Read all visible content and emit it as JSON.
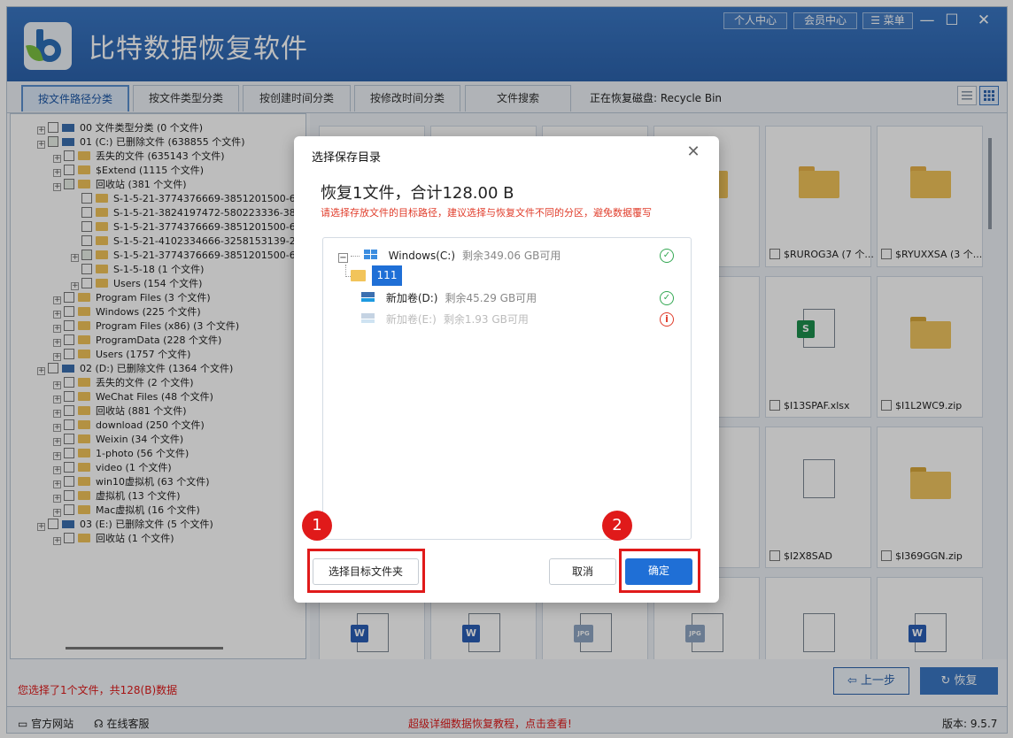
{
  "app": {
    "title": "比特数据恢复软件",
    "top_buttons": [
      "个人中心",
      "会员中心",
      "菜单"
    ],
    "recovering_disk": "正在恢复磁盘: Recycle Bin"
  },
  "tabs": [
    "按文件路径分类",
    "按文件类型分类",
    "按创建时间分类",
    "按修改时间分类",
    "文件搜索"
  ],
  "tree": {
    "items": [
      {
        "text": "00 文件类型分类  (0 个文件)",
        "level": 0,
        "type": "drive",
        "checked": false
      },
      {
        "text": "01 (C:) 已删除文件  (638855 个文件)",
        "level": 0,
        "type": "drive",
        "checked": true
      },
      {
        "text": "丢失的文件  (635143 个文件)",
        "level": 1,
        "type": "folder",
        "checked": false
      },
      {
        "text": "$Extend  (1115 个文件)",
        "level": 1,
        "type": "folder",
        "checked": false
      },
      {
        "text": "回收站  (381 个文件)",
        "level": 1,
        "type": "folder",
        "checked": true
      },
      {
        "text": "S-1-5-21-3774376669-3851201500-6941740",
        "level": 2,
        "type": "folder",
        "checked": false
      },
      {
        "text": "S-1-5-21-3824197472-580223336-38904055",
        "level": 2,
        "type": "folder",
        "checked": false
      },
      {
        "text": "S-1-5-21-3774376669-3851201500-6941740",
        "level": 2,
        "type": "folder",
        "checked": false
      },
      {
        "text": "S-1-5-21-4102334666-3258153139-2670408",
        "level": 2,
        "type": "folder",
        "checked": false
      },
      {
        "text": "S-1-5-21-3774376669-3851201500-6941740",
        "level": 2,
        "type": "folder",
        "checked": true
      },
      {
        "text": "S-1-5-18  (1 个文件)",
        "level": 2,
        "type": "folder",
        "checked": false
      },
      {
        "text": "Users  (154 个文件)",
        "level": 2,
        "type": "folder",
        "checked": false
      },
      {
        "text": "Program Files  (3 个文件)",
        "level": 1,
        "type": "folder",
        "checked": false
      },
      {
        "text": "Windows  (225 个文件)",
        "level": 1,
        "type": "folder",
        "checked": false
      },
      {
        "text": "Program Files (x86)  (3 个文件)",
        "level": 1,
        "type": "folder",
        "checked": false
      },
      {
        "text": "ProgramData  (228 个文件)",
        "level": 1,
        "type": "folder",
        "checked": false
      },
      {
        "text": "Users  (1757 个文件)",
        "level": 1,
        "type": "folder",
        "checked": false
      },
      {
        "text": "02 (D:) 已删除文件  (1364 个文件)",
        "level": 0,
        "type": "drive",
        "checked": false
      },
      {
        "text": "丢失的文件  (2 个文件)",
        "level": 1,
        "type": "folder",
        "checked": false
      },
      {
        "text": "WeChat Files  (48 个文件)",
        "level": 1,
        "type": "folder",
        "checked": false
      },
      {
        "text": "回收站  (881 个文件)",
        "level": 1,
        "type": "folder",
        "checked": false
      },
      {
        "text": "download  (250 个文件)",
        "level": 1,
        "type": "folder",
        "checked": false
      },
      {
        "text": "Weixin  (34 个文件)",
        "level": 1,
        "type": "folder",
        "checked": false
      },
      {
        "text": "1-photo  (56 个文件)",
        "level": 1,
        "type": "folder",
        "checked": false
      },
      {
        "text": "video  (1 个文件)",
        "level": 1,
        "type": "folder",
        "checked": false
      },
      {
        "text": "win10虚拟机  (63 个文件)",
        "level": 1,
        "type": "folder",
        "checked": false
      },
      {
        "text": "虚拟机  (13 个文件)",
        "level": 1,
        "type": "folder",
        "checked": false
      },
      {
        "text": "Mac虚拟机  (16 个文件)",
        "level": 1,
        "type": "folder",
        "checked": false
      },
      {
        "text": "03 (E:) 已删除文件  (5 个文件)",
        "level": 0,
        "type": "drive",
        "checked": false
      },
      {
        "text": "回收站  (1 个文件)",
        "level": 1,
        "type": "folder",
        "checked": false
      }
    ]
  },
  "grid": {
    "cards": [
      {
        "label": "(97 ...",
        "icon": "folder",
        "col": 3,
        "row": 0
      },
      {
        "label": "$RUROG3A (7 个...",
        "icon": "folder",
        "col": 4,
        "row": 0
      },
      {
        "label": "$RYUXXSA (3 个...",
        "icon": "folder",
        "col": 5,
        "row": 0
      },
      {
        "label": "$I13SPAF.xlsx",
        "icon": "excel",
        "col": 4,
        "row": 1
      },
      {
        "label": "$I1L2WC9.zip",
        "icon": "zip",
        "col": 5,
        "row": 1
      },
      {
        "label": "$I2X8SAD",
        "icon": "file",
        "col": 4,
        "row": 2
      },
      {
        "label": "$I369GGN.zip",
        "icon": "zip",
        "col": 5,
        "row": 2
      }
    ]
  },
  "status": {
    "selection": "您选择了1个文件，共128(B)数据",
    "prev_label": "上一步",
    "recover_label": "恢复"
  },
  "footer": {
    "site": "官方网站",
    "support": "在线客服",
    "promo": "超级详细数据恢复教程，点击查看!",
    "version": "版本: 9.5.7"
  },
  "dialog": {
    "title": "选择保存目录",
    "headline": "恢复1文件，合计128.00 B",
    "warning": "请选择存放文件的目标路径，建议选择与恢复文件不同的分区，避免数据覆写",
    "drives": [
      {
        "name": "Windows(C:)",
        "free": "剩余349.06 GB可用",
        "status": "ok"
      },
      {
        "name": "新加卷(D:)",
        "free": "剩余45.29 GB可用",
        "status": "ok"
      },
      {
        "name": "新加卷(E:)",
        "free": "剩余1.93 GB可用",
        "status": "warn"
      }
    ],
    "selected_folder": "111",
    "choose_label": "选择目标文件夹",
    "cancel_label": "取消",
    "ok_label": "确定",
    "badge1": "1",
    "badge2": "2"
  },
  "colors": {
    "brand": "#2c63ad",
    "primary_button": "#1f6fd6",
    "alert": "#e01a1a",
    "ok": "#34a853"
  }
}
